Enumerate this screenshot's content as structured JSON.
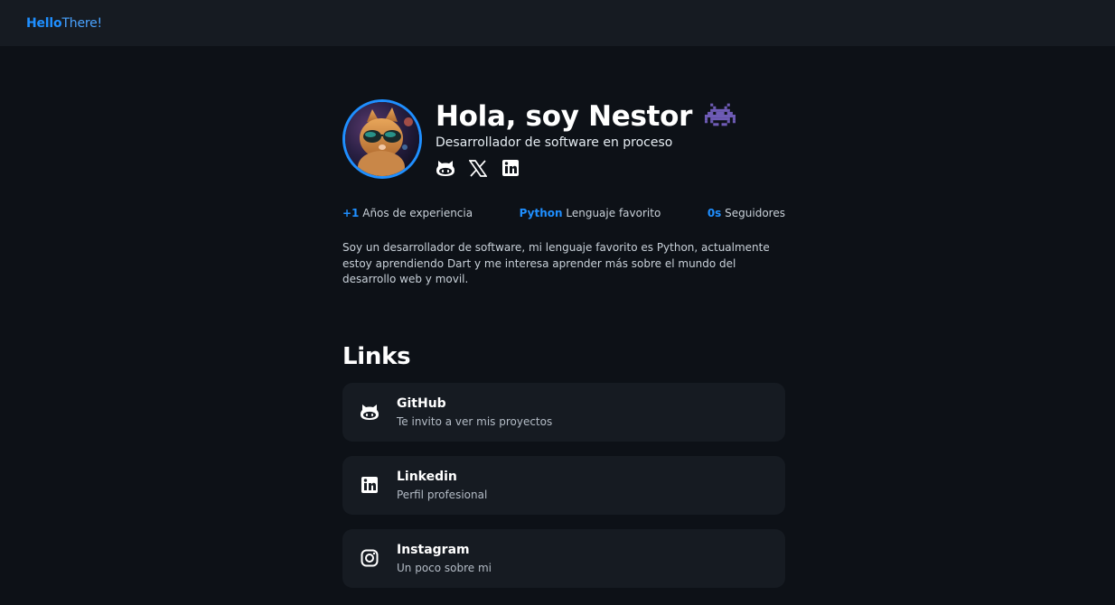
{
  "navbar": {
    "brand_part1": "Hello",
    "brand_part2": "There!"
  },
  "profile": {
    "title": "Hola, soy Nestor",
    "title_icon": "space-invader-icon",
    "subtitle": "Desarrollador de software en proceso",
    "avatar_description": "cat-with-sunglasses-avatar",
    "socials": [
      {
        "name": "GitHub",
        "icon": "github-icon"
      },
      {
        "name": "X",
        "icon": "x-icon"
      },
      {
        "name": "LinkedIn",
        "icon": "linkedin-icon"
      }
    ]
  },
  "stats": [
    {
      "value": "+1",
      "label": "Años de experiencia"
    },
    {
      "value": "Python",
      "label": "Lenguaje favorito"
    },
    {
      "value": "0s",
      "label": "Seguidores"
    }
  ],
  "about": "Soy un desarrollador de software, mi lenguaje favorito es Python, actualmente estoy aprendiendo Dart y me interesa aprender más sobre el mundo del desarrollo web y movil.",
  "links": {
    "title": "Links",
    "items": [
      {
        "name": "GitHub",
        "desc": "Te invito a ver mis proyectos",
        "icon": "github-icon"
      },
      {
        "name": "Linkedin",
        "desc": "Perfil profesional",
        "icon": "linkedin-icon"
      },
      {
        "name": "Instagram",
        "desc": "Un poco sobre mi",
        "icon": "instagram-icon"
      }
    ]
  },
  "colors": {
    "accent": "#1f8fff",
    "background": "#0d1117",
    "card": "#161b22",
    "emoji": "#6e5bb5"
  }
}
